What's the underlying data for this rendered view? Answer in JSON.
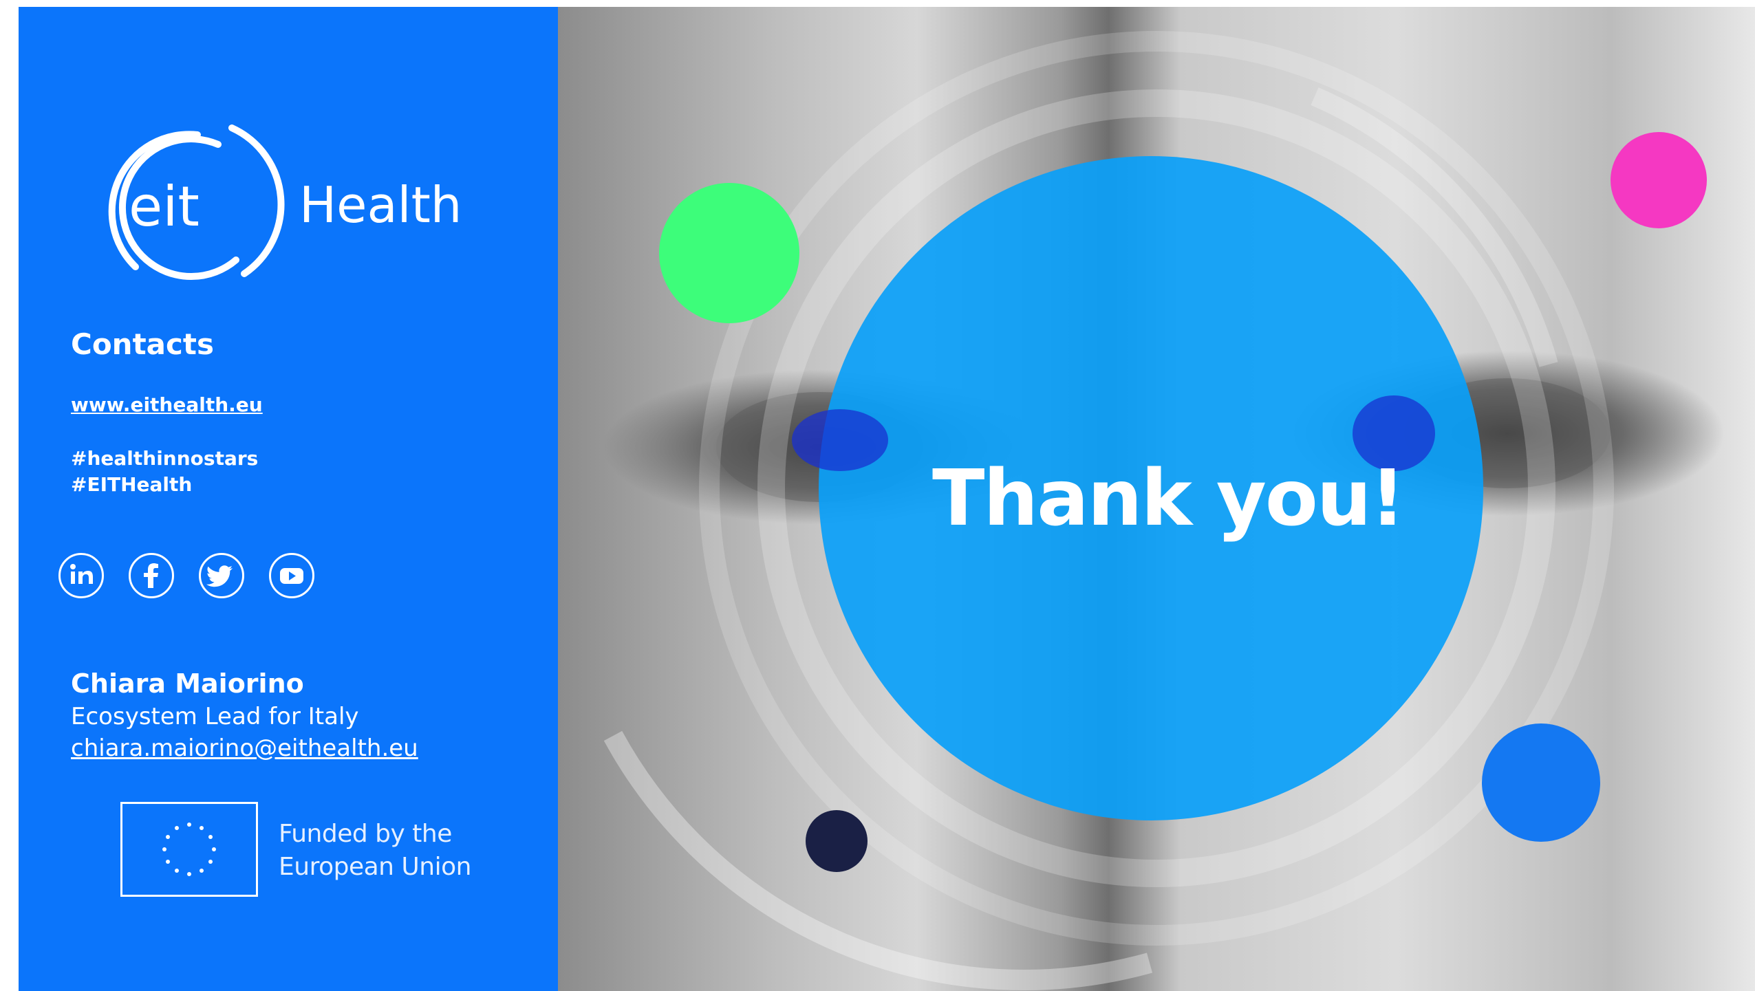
{
  "logo": {
    "mark_text": "eit",
    "brand_text": "Health"
  },
  "contacts": {
    "title": "Contacts",
    "website": "www.eithealth.eu",
    "hashtags": [
      "#healthinnostars",
      "#EITHealth"
    ]
  },
  "social_icons": [
    "linkedin-icon",
    "facebook-icon",
    "twitter-icon",
    "youtube-icon"
  ],
  "person": {
    "name": "Chiara Maiorino",
    "role": "Ecosystem Lead for Italy",
    "email": "chiara.maiorino@eithealth.eu"
  },
  "eu": {
    "line1": "Funded by the",
    "line2": "European Union"
  },
  "headline": "Thank you!",
  "colors": {
    "panel_blue": "#0b75fb",
    "center_circle": "#0aa0f8",
    "green_dot": "#3dfd7a",
    "magenta_dot": "#f538c2",
    "navy_dot": "#1a2045",
    "blue_dot": "#1478f2"
  }
}
